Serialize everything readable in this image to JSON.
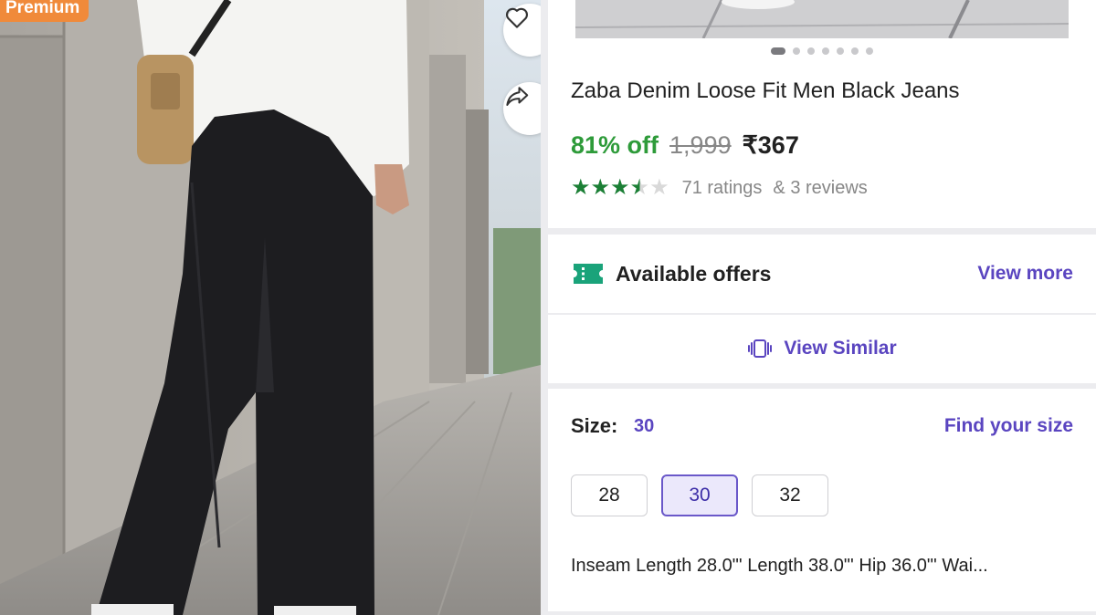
{
  "badge": {
    "premium": "Premium"
  },
  "actions": {
    "wishlist_icon": "heart-icon",
    "share_icon": "share-icon"
  },
  "gallery": {
    "dot_count": 7,
    "active_index": 0
  },
  "product": {
    "title": "Zaba Denim Loose Fit Men Black Jeans",
    "discount": "81% off",
    "mrp": "1,999",
    "price": "₹367",
    "rating_value": 3.5,
    "ratings": "71 ratings",
    "reviews": "& 3 reviews"
  },
  "offers": {
    "label": "Available offers",
    "link": "View more",
    "icon": "ticket-icon"
  },
  "similar": {
    "label": "View Similar",
    "icon": "similar-icon"
  },
  "size": {
    "label": "Size:",
    "selected": "30",
    "find_link": "Find your size",
    "options": [
      "28",
      "30",
      "32"
    ],
    "measurements": "Inseam Length 28.0\"'  Length 38.0\"'  Hip 36.0\"'  Wai..."
  },
  "colors": {
    "accent": "#5a45c0",
    "discount": "#2e9b3a",
    "star": "#1b7f35",
    "premium": "#f08a3a"
  }
}
